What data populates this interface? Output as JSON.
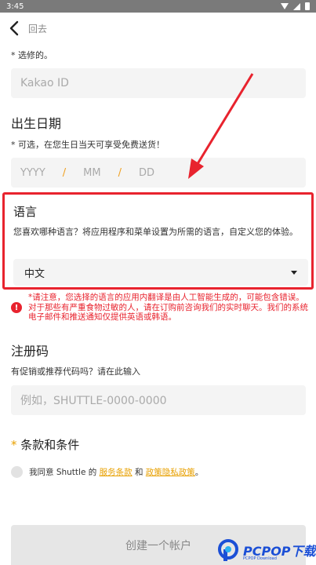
{
  "status_bar": {
    "time": "3:45"
  },
  "header": {
    "back_label": "回去"
  },
  "optional_note": "* 选修的。",
  "kakao": {
    "placeholder": "Kakao ID"
  },
  "birthday": {
    "title": "出生日期",
    "note": "* 可选，在您生日当天可享受免费送货！",
    "year": "YYYY",
    "month": "MM",
    "day": "DD",
    "separator": "/"
  },
  "language": {
    "title": "语言",
    "description": "您喜欢哪种语言？将应用程序和菜单设置为所需的语言，自定义您的体验。",
    "selected": "中文"
  },
  "warning": {
    "text": "*请注意，您选择的语言的应用内翻译是由人工智能生成的，可能包含错误。对于那些有严重食物过敏的人，请在订购前咨询我们的实时聊天。我们的系统电子邮件和推送通知仅提供英语或韩语。"
  },
  "referral": {
    "title": "注册码",
    "note": "有促销或推荐代码吗？请在此输入",
    "placeholder": "例如，SHUTTLE-0000-0000"
  },
  "terms": {
    "star": "*",
    "title": "条款和条件",
    "agree_prefix": "我同意 Shuttle 的",
    "terms_link": "服务条款",
    "and": "和",
    "privacy_link": "政策隐私政策",
    "suffix": "。"
  },
  "create_button": {
    "label": "创建一个帐户"
  },
  "watermark": {
    "brand": "PCPOP下载",
    "sub": "PCPOP Download"
  },
  "colors": {
    "accent": "#e8a000",
    "error": "#e8232e",
    "annotation": "#e8232e"
  }
}
